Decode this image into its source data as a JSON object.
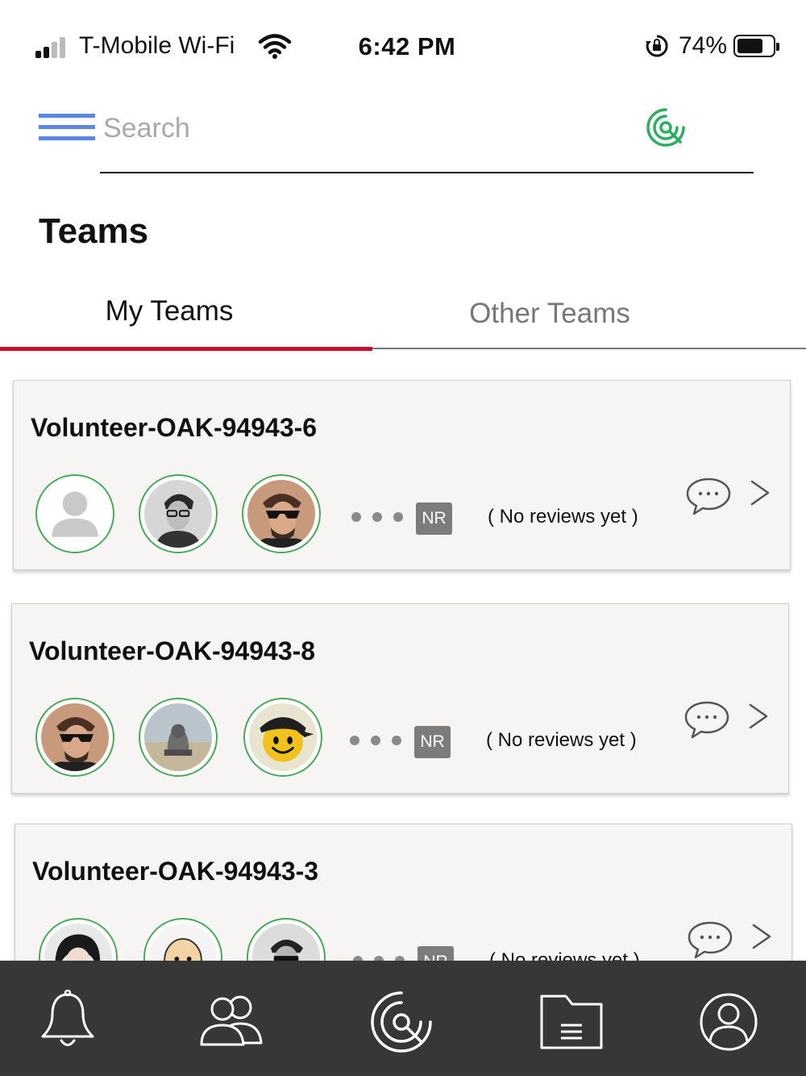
{
  "status_bar": {
    "carrier": "T-Mobile Wi-Fi",
    "time": "6:42 PM",
    "battery_percent": "74%",
    "battery_level": 0.74
  },
  "header": {
    "search_placeholder": "Search"
  },
  "page": {
    "title": "Teams"
  },
  "tabs": [
    {
      "label": "My Teams",
      "active": true
    },
    {
      "label": "Other Teams",
      "active": false
    }
  ],
  "teams": [
    {
      "name": "Volunteer-OAK-94943-6",
      "rating_badge": "NR",
      "reviews_text": "( No reviews yet )",
      "avatars": [
        "default-user",
        "man-glasses-bw",
        "man-sunglasses"
      ]
    },
    {
      "name": "Volunteer-OAK-94943-8",
      "rating_badge": "NR",
      "reviews_text": "( No reviews yet )",
      "avatars": [
        "man-sunglasses",
        "hooded-person-seaside",
        "smiley-cap"
      ]
    },
    {
      "name": "Volunteer-OAK-94943-3",
      "rating_badge": "NR",
      "reviews_text": "( No reviews yet )",
      "avatars": [
        "woman-dark-hair",
        "bald-cartoon",
        "man-shades-bw"
      ]
    }
  ],
  "bottom_nav": [
    {
      "icon": "bell-icon"
    },
    {
      "icon": "team-icon"
    },
    {
      "icon": "radar-icon"
    },
    {
      "icon": "folder-icon"
    },
    {
      "icon": "profile-icon"
    }
  ],
  "colors": {
    "accent_red": "#c8102e",
    "avatar_ring_green": "#4aa85a",
    "menu_blue": "#5b87e0",
    "nav_bg": "#373737",
    "badge_gray": "#7c7c7c"
  }
}
